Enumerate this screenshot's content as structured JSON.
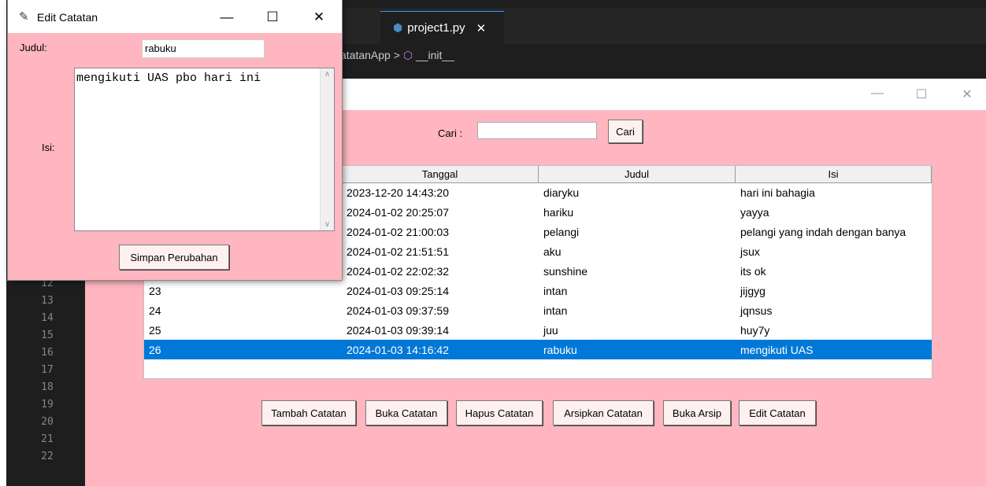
{
  "vscode": {
    "tab_label": "project1.py",
    "tab_close": "✕",
    "breadcrumb_class": "atatanApp",
    "breadcrumb_sep": ">",
    "breadcrumb_method": "__init__",
    "line_numbers": [
      "12",
      "13",
      "14",
      "15",
      "16",
      "17",
      "18",
      "19",
      "20",
      "21",
      "22"
    ]
  },
  "main_window": {
    "controls": {
      "minimize": "—",
      "maximize": "☐",
      "close": "✕"
    },
    "search": {
      "label": "Cari :",
      "value": "",
      "button": "Cari"
    },
    "table": {
      "columns": [
        "",
        "Tanggal",
        "Judul",
        "Isi"
      ],
      "rows": [
        {
          "id": "",
          "tanggal": "2023-12-20 14:43:20",
          "judul": "diaryku",
          "isi": "hari ini bahagia"
        },
        {
          "id": "",
          "tanggal": "2024-01-02 20:25:07",
          "judul": "hariku",
          "isi": "yayya"
        },
        {
          "id": "",
          "tanggal": "2024-01-02 21:00:03",
          "judul": "pelangi",
          "isi": "pelangi yang indah dengan banya"
        },
        {
          "id": "",
          "tanggal": "2024-01-02 21:51:51",
          "judul": "aku",
          "isi": "jsux"
        },
        {
          "id": "",
          "tanggal": "2024-01-02 22:02:32",
          "judul": "sunshine",
          "isi": "its ok"
        },
        {
          "id": "23",
          "tanggal": "2024-01-03 09:25:14",
          "judul": "intan",
          "isi": "jijgyg"
        },
        {
          "id": "24",
          "tanggal": "2024-01-03 09:37:59",
          "judul": "intan",
          "isi": "jqnsus"
        },
        {
          "id": "25",
          "tanggal": "2024-01-03 09:39:14",
          "judul": "juu",
          "isi": "huy7y"
        },
        {
          "id": "26",
          "tanggal": "2024-01-03 14:16:42",
          "judul": "rabuku",
          "isi": "mengikuti UAS"
        }
      ],
      "selected_index": 8
    },
    "actions": [
      "Tambah Catatan",
      "Buka Catatan",
      "Hapus Catatan",
      "Arsipkan Catatan",
      "Buka Arsip",
      "Edit Catatan"
    ]
  },
  "edit_dialog": {
    "title": "Edit Catatan",
    "controls": {
      "minimize": "—",
      "maximize": "☐",
      "close": "✕"
    },
    "judul_label": "Judul:",
    "judul_value": "rabuku",
    "isi_label": "Isi:",
    "isi_value": "mengikuti UAS pbo hari ini",
    "save_button": "Simpan Perubahan"
  },
  "colors": {
    "tk_background": "#ffb6c1",
    "selection": "#0078d7",
    "vscode_bg": "#1e1e1e"
  }
}
